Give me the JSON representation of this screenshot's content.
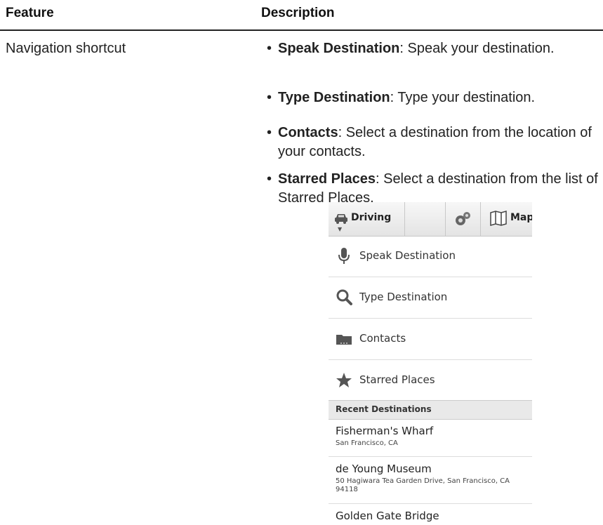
{
  "table": {
    "headers": {
      "feature": "Feature",
      "description": "Description"
    },
    "rows": [
      {
        "feature": "Navigation shortcut",
        "bullets": [
          {
            "term": "Speak Destination",
            "text": ": Speak your destination."
          },
          {
            "term": "Type Destination",
            "text": ": Type your destination."
          },
          {
            "term": "Contacts",
            "text": ": Select a destination from the location of your contacts."
          },
          {
            "term": "Starred Places",
            "text": ": Select a destination from the list of Starred Places."
          }
        ]
      }
    ]
  },
  "bullet_symbol": "•",
  "phone": {
    "toolbar": {
      "mode_label": "Driving",
      "map_label": "Map"
    },
    "menu": [
      {
        "label": "Speak Destination",
        "icon": "microphone-icon"
      },
      {
        "label": "Type Destination",
        "icon": "search-icon"
      },
      {
        "label": "Contacts",
        "icon": "contacts-icon"
      },
      {
        "label": "Starred Places",
        "icon": "star-icon"
      }
    ],
    "recent_header": "Recent Destinations",
    "recent": [
      {
        "title": "Fisherman's Wharf",
        "subtitle": "San Francisco, CA"
      },
      {
        "title": "de Young Museum",
        "subtitle": "50 Hagiwara Tea Garden Drive, San Francisco, CA 94118"
      },
      {
        "title": "Golden Gate Bridge",
        "subtitle": ""
      }
    ]
  }
}
